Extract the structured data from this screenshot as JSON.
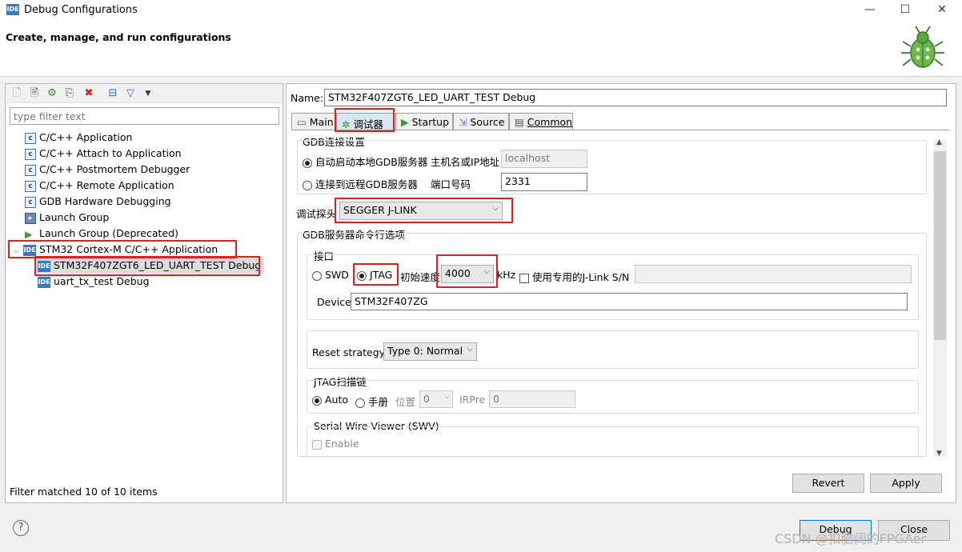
{
  "window": {
    "title": "Debug Configurations",
    "icon_text": "IDE",
    "minimize": "—",
    "maximize": "☐",
    "close": "✕"
  },
  "header": {
    "title": "Create, manage, and run configurations"
  },
  "left": {
    "filter_placeholder": "type filter text",
    "tree": [
      {
        "label": "C/C++ Application",
        "icon": "c-icon"
      },
      {
        "label": "C/C++ Attach to Application",
        "icon": "c-icon"
      },
      {
        "label": "C/C++ Postmortem Debugger",
        "icon": "c-icon"
      },
      {
        "label": "C/C++ Remote Application",
        "icon": "c-icon"
      },
      {
        "label": "GDB Hardware Debugging",
        "icon": "c-icon"
      },
      {
        "label": "Launch Group",
        "icon": "launch-group-icon"
      },
      {
        "label": "Launch Group (Deprecated)",
        "icon": "play-icon"
      },
      {
        "label": "STM32 Cortex-M C/C++ Application",
        "icon": "ide-icon"
      },
      {
        "label": "STM32F407ZGT6_LED_UART_TEST Debug",
        "icon": "ide-icon"
      },
      {
        "label": "uart_tx_test Debug",
        "icon": "ide-icon"
      }
    ],
    "status": "Filter matched 10 of 10 items"
  },
  "right": {
    "name_label": "Name:",
    "name_value": "STM32F407ZGT6_LED_UART_TEST Debug",
    "tabs": [
      {
        "label": "Main"
      },
      {
        "label": "调试器"
      },
      {
        "label": "Startup"
      },
      {
        "label": "Source"
      },
      {
        "label": "Common"
      }
    ],
    "gdb_connection": {
      "title": "GDB连接设置",
      "local_label": "自动启动本地GDB服务器",
      "host_label": "主机名或IP地址",
      "host_value": "localhost",
      "remote_label": "连接到远程GDB服务器",
      "port_label": "端口号码",
      "port_value": "2331"
    },
    "probe": {
      "label": "调试探头",
      "value": "SEGGER J-LINK"
    },
    "gdb_server_options": {
      "title": "GDB服务器命令行选项",
      "interface_title": "接口",
      "swd_label": "SWD",
      "jtag_label": "JTAG",
      "speed_label": "初始速度",
      "speed_value": "4000",
      "speed_unit": "kHz",
      "sn_label": "使用专用的J-Link S/N",
      "device_label": "Device",
      "device_value": "STM32F407ZG",
      "reset_label": "Reset strategy",
      "reset_value": "Type 0: Normal",
      "jtag_chain_title": "JTAG扫描链",
      "auto_label": "Auto",
      "manual_label": "手册",
      "position_label": "位置",
      "position_value": "0",
      "irpre_label": "IRPre",
      "irpre_value": "0",
      "swv_title": "Serial Wire Viewer (SWV)",
      "enable_label": "Enable"
    },
    "revert_label": "Revert",
    "apply_label": "Apply"
  },
  "footer": {
    "help": "?",
    "debug_label": "Debug",
    "close_label": "Close",
    "watermark": "CSDN @扣脑阔的FPGAer"
  }
}
